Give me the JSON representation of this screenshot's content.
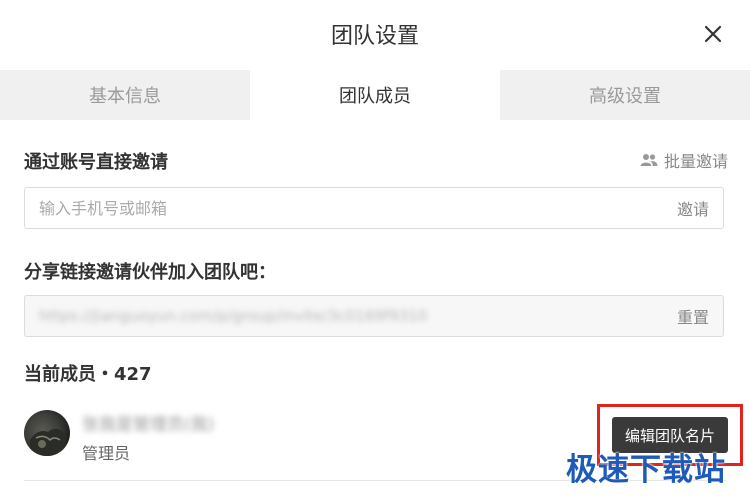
{
  "dialog": {
    "title": "团队设置",
    "close_icon": "close-icon"
  },
  "tabs": [
    {
      "label": "基本信息",
      "active": false
    },
    {
      "label": "团队成员",
      "active": true
    },
    {
      "label": "高级设置",
      "active": false
    }
  ],
  "invite": {
    "label": "通过账号直接邀请",
    "batch_label": "批量邀请",
    "batch_icon": "people-icon",
    "input_value": "",
    "input_placeholder": "输入手机号或邮箱",
    "action_label": "邀请"
  },
  "share": {
    "label": "分享链接邀请伙伴加入团队吧：",
    "link_text": "https://jianguoyun.com/p/group/invite/3c0169f9310",
    "reset_label": "重置"
  },
  "members": {
    "label": "当前成员・427",
    "list": [
      {
        "name": "张我是管理员(我)",
        "role": "管理员",
        "action_label": "编辑团队名片"
      }
    ]
  },
  "watermark": "极速下载站",
  "colors": {
    "tab_bar_bg": "#f0f0f0",
    "button_dark": "#3a3a3a",
    "highlight_red": "#e0231b",
    "watermark_blue": "#1e5bb8"
  }
}
